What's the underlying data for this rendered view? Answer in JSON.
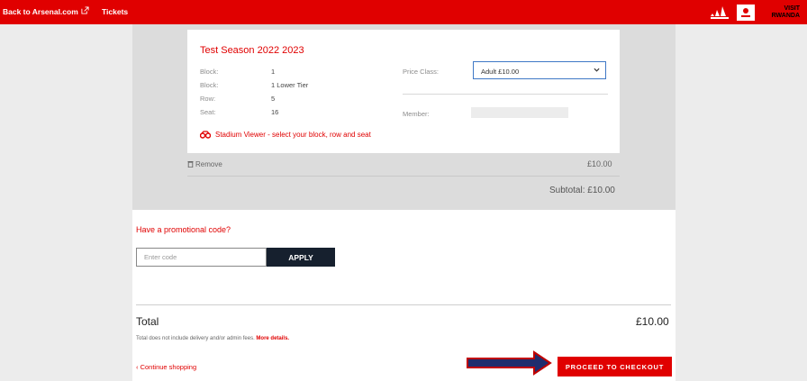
{
  "topbar": {
    "back_link": "Back to Arsenal.com",
    "tickets": "Tickets",
    "sponsors": {
      "adidas": "adidas",
      "emirates": "Emirates",
      "visit_line1": "VISIT",
      "visit_line2": "RWANDA"
    }
  },
  "ticket": {
    "title": "Test Season 2022 2023",
    "details": [
      {
        "label": "Block:",
        "value": "1"
      },
      {
        "label": "Block:",
        "value": "1 Lower Tier"
      },
      {
        "label": "Row:",
        "value": "5"
      },
      {
        "label": "Seat:",
        "value": "16"
      }
    ],
    "price_class_label": "Price Class:",
    "price_class_value": "Adult £10.00",
    "member_label": "Member:",
    "stadium_viewer": "Stadium Viewer - select your block, row and seat",
    "remove": "Remove",
    "line_price": "£10.00"
  },
  "subtotal": "Subtotal: £10.00",
  "promo": {
    "question": "Have a promotional code?",
    "placeholder": "Enter code",
    "apply": "APPLY"
  },
  "total": {
    "label": "Total",
    "value": "£10.00",
    "note": "Total does not include delivery and/or admin fees.",
    "more": "More details."
  },
  "continue": "‹ Continue shopping",
  "checkout": "PROCEED TO CHECKOUT",
  "colors": {
    "brand_red": "#e00000",
    "dark_button": "#16202e",
    "arrow_fill": "#1f2d6e",
    "arrow_stroke": "#c00000"
  }
}
